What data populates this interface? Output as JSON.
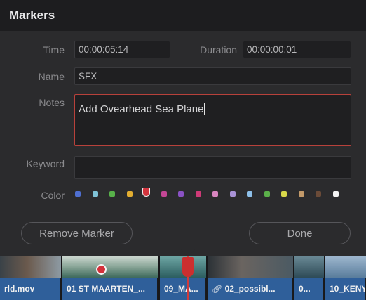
{
  "dialog": {
    "title": "Markers",
    "time_label": "Time",
    "time_value": "00:00:05:14",
    "duration_label": "Duration",
    "duration_value": "00:00:00:01",
    "name_label": "Name",
    "name_value": "SFX",
    "notes_label": "Notes",
    "notes_value": "Add Ovearhead Sea Plane",
    "keyword_label": "Keyword",
    "keyword_value": "",
    "color_label": "Color",
    "colors": [
      "#4f6fd1",
      "#7fc2d6",
      "#58b14a",
      "#e3ae31",
      "#d3353e",
      "#c44796",
      "#8a52c4",
      "#cf3a77",
      "#d986c0",
      "#a993d6",
      "#8ec0ea",
      "#5bb04a",
      "#d8d84a",
      "#c39a6a",
      "#6b4b38",
      "#f3f3f3"
    ],
    "selected_color_index": 4,
    "remove_button": "Remove Marker",
    "done_button": "Done"
  },
  "timeline": {
    "clips": [
      {
        "label": "rld.mov",
        "thumb": "#5c6a72"
      },
      {
        "label": "01 ST MAARTEN_...",
        "thumb": "#7c9486"
      },
      {
        "label": "09_MA...",
        "thumb": "#3f6f72"
      },
      {
        "label": "02_possibl...",
        "thumb": "#546069",
        "icon": "link-icon"
      },
      {
        "label": "0...",
        "thumb": "#3b5966"
      },
      {
        "label": "10_KENY",
        "thumb": "#6a8aa6"
      }
    ]
  }
}
